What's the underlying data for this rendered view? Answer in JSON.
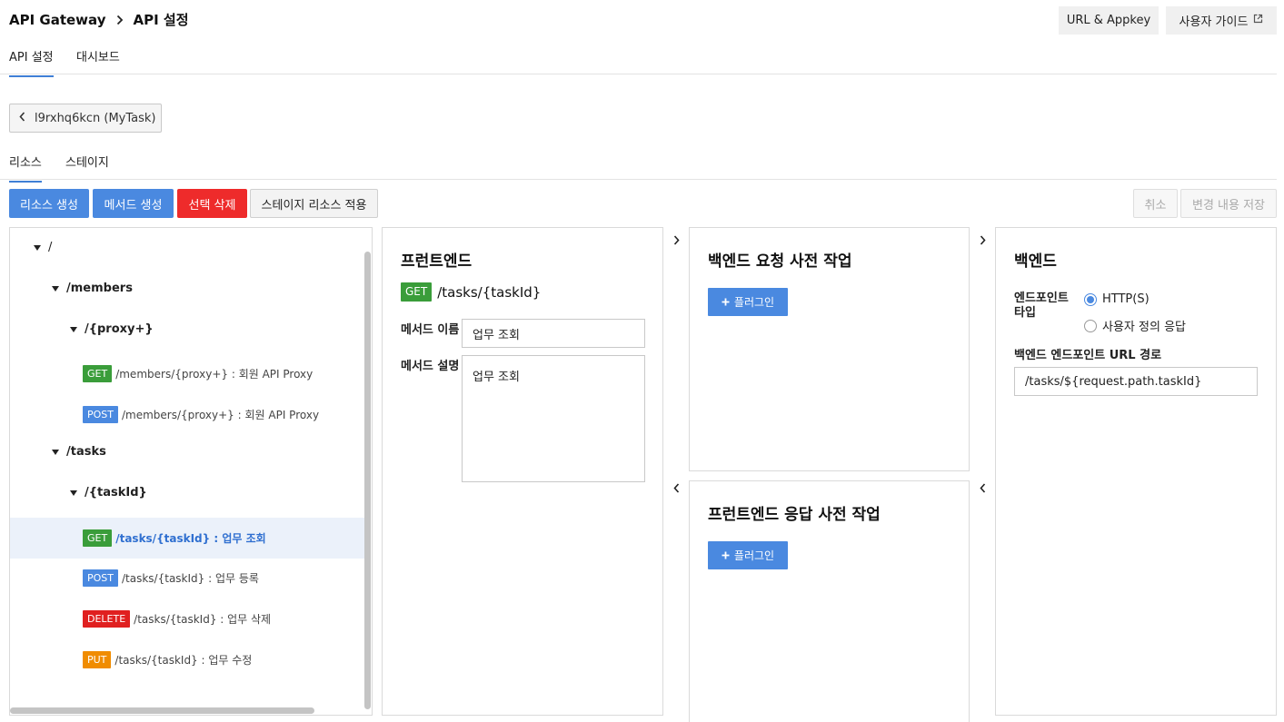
{
  "breadcrumb": {
    "root": "API Gateway",
    "current": "API 설정"
  },
  "header_buttons": {
    "url_appkey": "URL & Appkey",
    "user_guide": "사용자 가이드"
  },
  "top_tabs": [
    "API 설정",
    "대시보드"
  ],
  "back_button": "l9rxhq6kcn (MyTask)",
  "sub_tabs": [
    "리소스",
    "스테이지"
  ],
  "actions": {
    "create_resource": "리소스 생성",
    "create_method": "메서드 생성",
    "delete_selected": "선택 삭제",
    "apply_stage_resource": "스테이지 리소스 적용",
    "cancel": "취소",
    "save_changes": "변경 내용 저장"
  },
  "tree": {
    "root": "/",
    "members": "/members",
    "members_proxy": "/{proxy+}",
    "members_methods": [
      {
        "method": "GET",
        "text": "/members/{proxy+} : 회원 API Proxy"
      },
      {
        "method": "POST",
        "text": "/members/{proxy+} : 회원 API Proxy"
      }
    ],
    "tasks": "/tasks",
    "tasks_taskid": "/{taskId}",
    "tasks_methods": [
      {
        "method": "GET",
        "text": "/tasks/{taskId} : 업무 조회"
      },
      {
        "method": "POST",
        "text": "/tasks/{taskId} : 업무 등록"
      },
      {
        "method": "DELETE",
        "text": "/tasks/{taskId} : 업무 삭제"
      },
      {
        "method": "PUT",
        "text": "/tasks/{taskId} : 업무 수정"
      }
    ]
  },
  "frontend": {
    "title": "프런트엔드",
    "method": "GET",
    "path": "/tasks/{taskId}",
    "name_label": "메서드 이름",
    "name_value": "업무 조회",
    "desc_label": "메서드 설명",
    "desc_value": "업무 조회"
  },
  "backend_pre": {
    "title": "백엔드 요청 사전 작업",
    "plugin_label": "플러그인"
  },
  "frontend_post": {
    "title": "프런트엔드 응답 사전 작업",
    "plugin_label": "플러그인"
  },
  "backend": {
    "title": "백엔드",
    "endpoint_type_label": "엔드포인트 타입",
    "endpoint_options": [
      "HTTP(S)",
      "사용자 정의 응답"
    ],
    "url_label": "백엔드 엔드포인트 URL 경로",
    "url_value": "/tasks/${request.path.taskId}"
  },
  "colors": {
    "primary": "#4a89e0",
    "danger": "#ee2b2b",
    "get": "#3a9d3a",
    "post": "#4a89e0",
    "delete": "#e02020",
    "put": "#f08c00",
    "selected_row": "#ebf1fa"
  }
}
